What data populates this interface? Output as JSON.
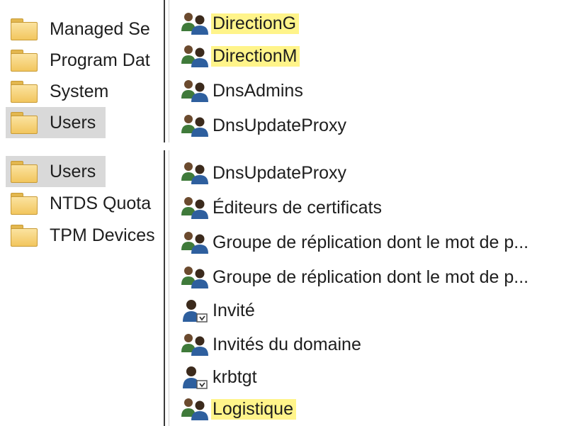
{
  "top": {
    "tree": [
      {
        "label": "Managed Se",
        "selected": false
      },
      {
        "label": "Program Dat",
        "selected": false
      },
      {
        "label": "System",
        "selected": false
      },
      {
        "label": "Users",
        "selected": true
      }
    ],
    "list": [
      {
        "label": "DirectionG",
        "icon": "group-icon",
        "highlighted": true
      },
      {
        "label": "DirectionM",
        "icon": "group-icon",
        "highlighted": true
      },
      {
        "label": "DnsAdmins",
        "icon": "group-icon",
        "highlighted": false
      },
      {
        "label": "DnsUpdateProxy",
        "icon": "group-icon",
        "highlighted": false
      }
    ]
  },
  "bottom": {
    "tree": [
      {
        "label": "Users",
        "selected": true
      },
      {
        "label": "NTDS Quota",
        "selected": false
      },
      {
        "label": "TPM Devices",
        "selected": false
      }
    ],
    "list": [
      {
        "label": "DnsUpdateProxy",
        "icon": "group-icon",
        "highlighted": false
      },
      {
        "label": "Éditeurs de certificats",
        "icon": "group-icon",
        "highlighted": false
      },
      {
        "label": "Groupe de réplication dont le mot de p...",
        "icon": "group-icon",
        "highlighted": false
      },
      {
        "label": "Groupe de réplication dont le mot de p...",
        "icon": "group-icon",
        "highlighted": false
      },
      {
        "label": "Invité",
        "icon": "user-icon",
        "highlighted": false
      },
      {
        "label": "Invités du domaine",
        "icon": "group-icon",
        "highlighted": false
      },
      {
        "label": "krbtgt",
        "icon": "user-icon",
        "highlighted": false
      },
      {
        "label": "Logistique",
        "icon": "group-icon",
        "highlighted": true
      }
    ]
  },
  "colors": {
    "highlight": "#fff48a",
    "selection": "#d9d9d9",
    "folder": "#f2c65e"
  }
}
